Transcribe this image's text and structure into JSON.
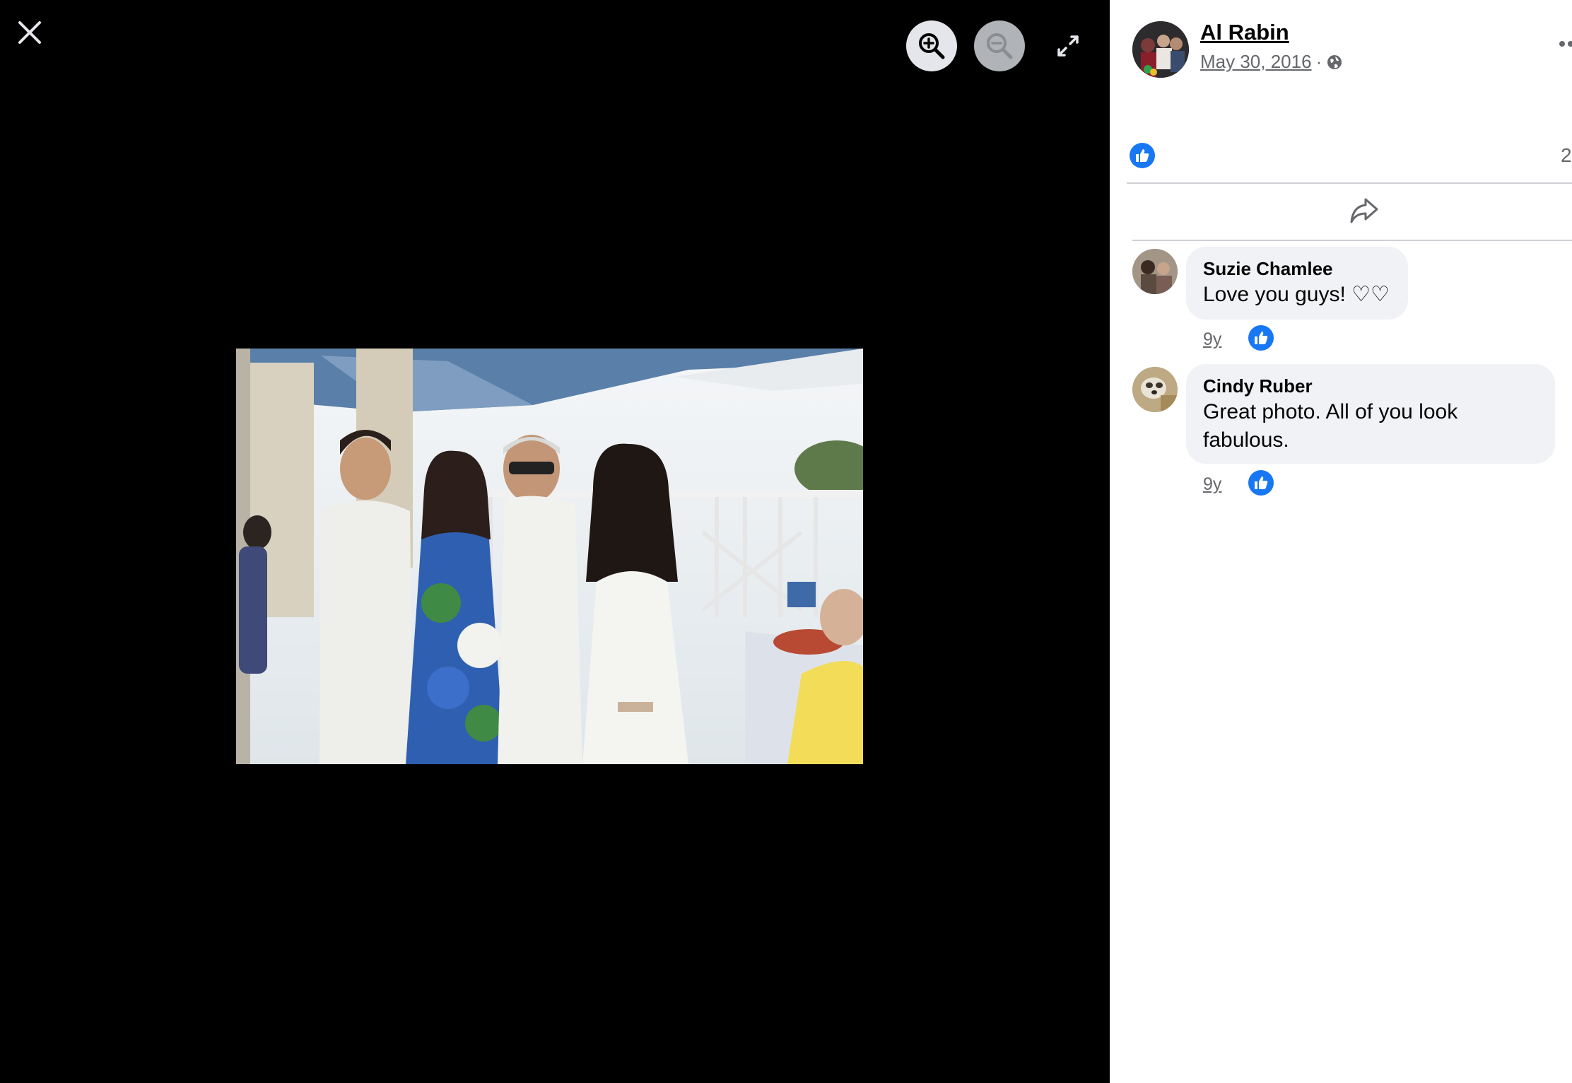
{
  "post": {
    "author": "Al Rabin",
    "date": "May 30, 2016",
    "separator": "·",
    "privacy_icon": "globe-icon",
    "reaction_icon": "like-icon",
    "reaction_count": "2"
  },
  "viewer": {
    "close_icon": "close-icon",
    "zoom_in_icon": "zoom-in-icon",
    "zoom_out_icon": "zoom-out-icon",
    "fullscreen_icon": "fullscreen-icon"
  },
  "comments": [
    {
      "name": "Suzie Chamlee",
      "text": "Love you guys! ♡♡",
      "time": "9y"
    },
    {
      "name": "Cindy Ruber",
      "text": "Great photo. All of you look fabulous.",
      "time": "9y"
    }
  ],
  "colors": {
    "accent": "#1877f2",
    "bubble": "#f0f2f5",
    "secondary_text": "#65676b"
  }
}
